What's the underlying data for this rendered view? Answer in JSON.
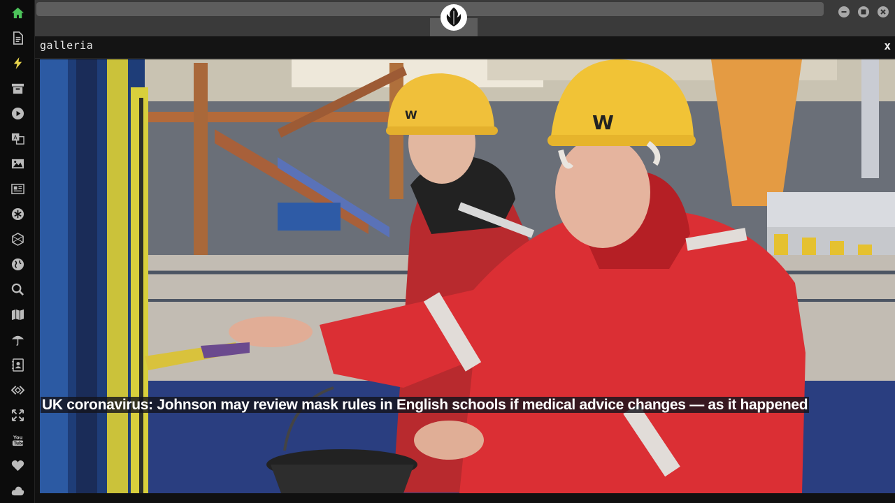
{
  "sidebar": {
    "items": [
      {
        "icon": "home-icon",
        "color": "#4cc35a"
      },
      {
        "icon": "document-icon"
      },
      {
        "icon": "lightning-icon"
      },
      {
        "icon": "archive-icon"
      },
      {
        "icon": "play-icon"
      },
      {
        "icon": "translate-icon"
      },
      {
        "icon": "image-icon"
      },
      {
        "icon": "newspaper-icon"
      },
      {
        "icon": "asterisk-icon"
      },
      {
        "icon": "hexagon-icon"
      },
      {
        "icon": "globe-icon"
      },
      {
        "icon": "search-icon"
      },
      {
        "icon": "map-icon"
      },
      {
        "icon": "umbrella-icon"
      },
      {
        "icon": "contact-icon"
      },
      {
        "icon": "code-icon"
      },
      {
        "icon": "expand-icon"
      },
      {
        "icon": "youtube-icon"
      },
      {
        "icon": "heart-icon"
      },
      {
        "icon": "cloud-icon"
      }
    ]
  },
  "topbar": {
    "emblem_icon": "rebel-alliance-icon",
    "window_controls": [
      "minimize-icon",
      "maximize-icon",
      "close-icon"
    ]
  },
  "panel": {
    "title": "galleria",
    "close_label": "x"
  },
  "gallery": {
    "caption": "UK coronavirus: Johnson may review mask rules in English schools if medical advice changes — as it happened"
  }
}
